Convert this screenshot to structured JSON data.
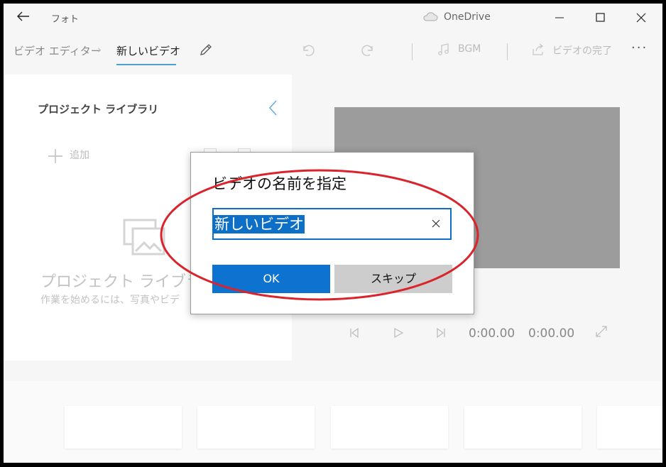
{
  "app": {
    "title": "フォト",
    "cloud_label": "OneDrive"
  },
  "toolbar": {
    "breadcrumb_root": "ビデオ エディター",
    "breadcrumb_sep": "›",
    "breadcrumb_current": "新しいビデオ",
    "bgm_label": "BGM",
    "finish_label": "ビデオの完了",
    "more_label": "···"
  },
  "library": {
    "title": "プロジェクト ライブラリ",
    "add_label": "追加",
    "empty_title": "プロジェクト ライブラリは",
    "empty_subtitle": "作業を始めるには、写真やビデ"
  },
  "player": {
    "current_time": "0:00.00",
    "total_time": "0:00.00"
  },
  "dialog": {
    "title": "ビデオの名前を指定",
    "input_value": "新しいビデオ",
    "ok_label": "OK",
    "skip_label": "スキップ"
  },
  "colors": {
    "accent": "#0e72d0",
    "annotation": "#d9242b"
  }
}
